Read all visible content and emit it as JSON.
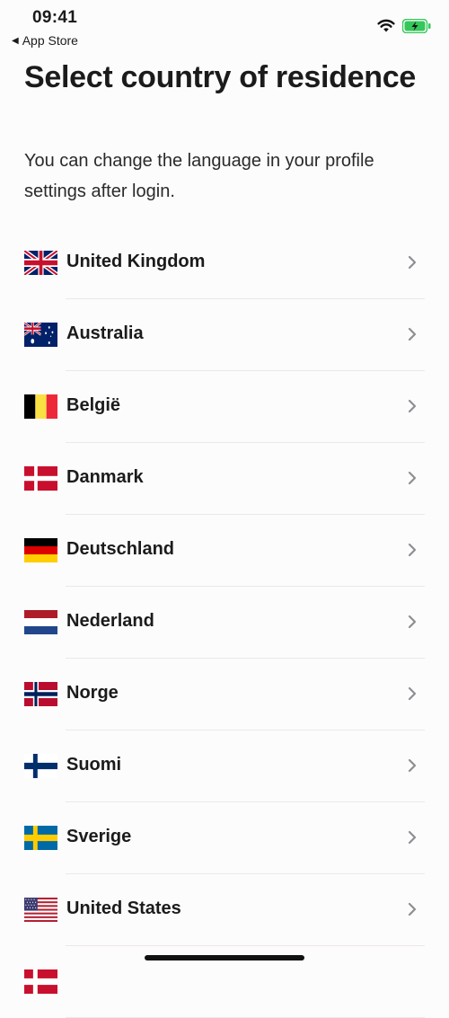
{
  "status_bar": {
    "time": "09:41",
    "back_label": "App Store",
    "icons": [
      "back-arrow-icon",
      "wifi-icon",
      "battery-charging-icon"
    ]
  },
  "header": {
    "title": "Select country of residence",
    "subtitle": "You can change the language in your profile settings after login."
  },
  "countries": [
    {
      "name": "United Kingdom",
      "flag": "uk-flag-icon"
    },
    {
      "name": "Australia",
      "flag": "australia-flag-icon"
    },
    {
      "name": "België",
      "flag": "belgium-flag-icon"
    },
    {
      "name": "Danmark",
      "flag": "denmark-flag-icon"
    },
    {
      "name": "Deutschland",
      "flag": "germany-flag-icon"
    },
    {
      "name": "Nederland",
      "flag": "netherlands-flag-icon"
    },
    {
      "name": "Norge",
      "flag": "norway-flag-icon"
    },
    {
      "name": "Suomi",
      "flag": "finland-flag-icon"
    },
    {
      "name": "Sverige",
      "flag": "sweden-flag-icon"
    },
    {
      "name": "United States",
      "flag": "usa-flag-icon"
    }
  ],
  "colors": {
    "background": "#fdfcfd",
    "text": "#1b1b1b",
    "divider": "#ebe7ea",
    "chevron": "#8e8e93",
    "battery": "#34c759"
  }
}
